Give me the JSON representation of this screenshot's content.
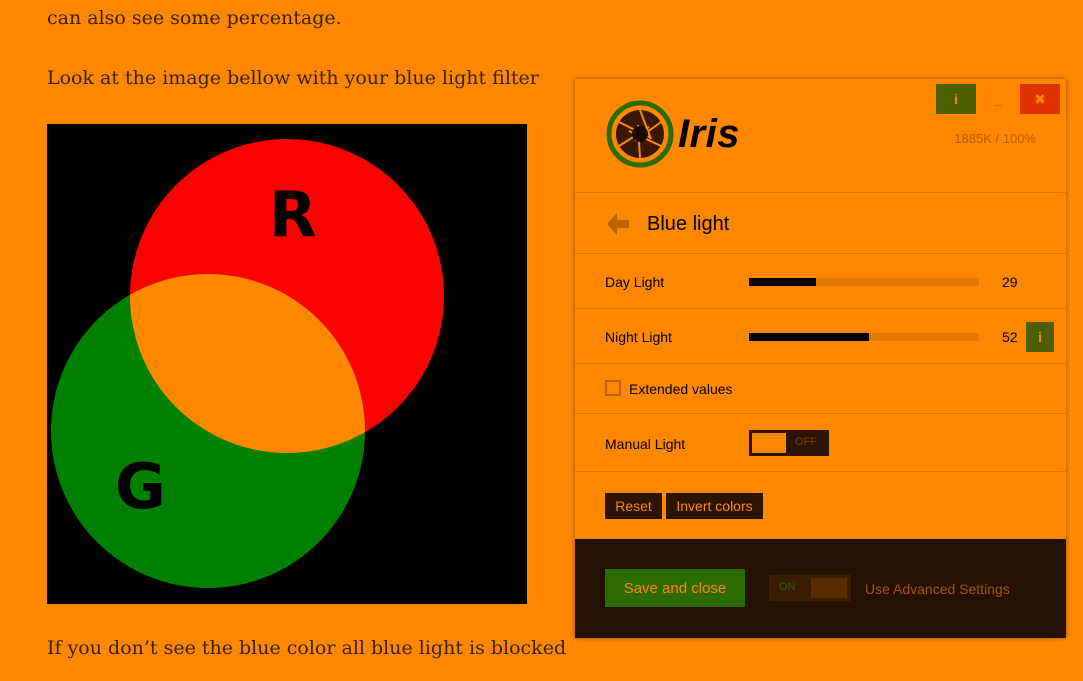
{
  "article": {
    "line1": "can also see some percentage.",
    "line2": "Look at the image bellow with your blue light filter",
    "line3": "If you don’t see the blue color all blue light is blocked"
  },
  "venn": {
    "red_label": "R",
    "green_label": "G",
    "colors": {
      "red": "#ff0000",
      "green": "#008000",
      "overlap": "#ff8800",
      "background": "#000000"
    }
  },
  "iris": {
    "app_name": "Iris",
    "stats": "1885K / 100%",
    "window_buttons": {
      "info": "i",
      "minimize": "_",
      "close": "✖"
    },
    "section_title": "Blue light",
    "day_light": {
      "label": "Day Light",
      "value": "29",
      "fraction": 0.29
    },
    "night_light": {
      "label": "Night Light",
      "value": "52",
      "fraction": 0.52,
      "info": "i"
    },
    "extended_values": {
      "label": "Extended values",
      "checked": false
    },
    "manual_light": {
      "label": "Manual Light",
      "toggle": "OFF"
    },
    "reset_label": "Reset",
    "invert_label": "Invert colors",
    "save_label": "Save and close",
    "advanced_toggle": "ON",
    "advanced_label": "Use Advanced Settings",
    "colors": {
      "accent": "#ff8800",
      "info_button": "#4d5f00",
      "close_button": "#e03300",
      "save_button": "#2b6b00",
      "footer": "#241100"
    },
    "icons": {
      "logo": "iris-aperture-icon",
      "back": "arrow-left-icon",
      "info": "info-icon",
      "minimize": "minimize-icon",
      "close": "close-icon"
    }
  }
}
